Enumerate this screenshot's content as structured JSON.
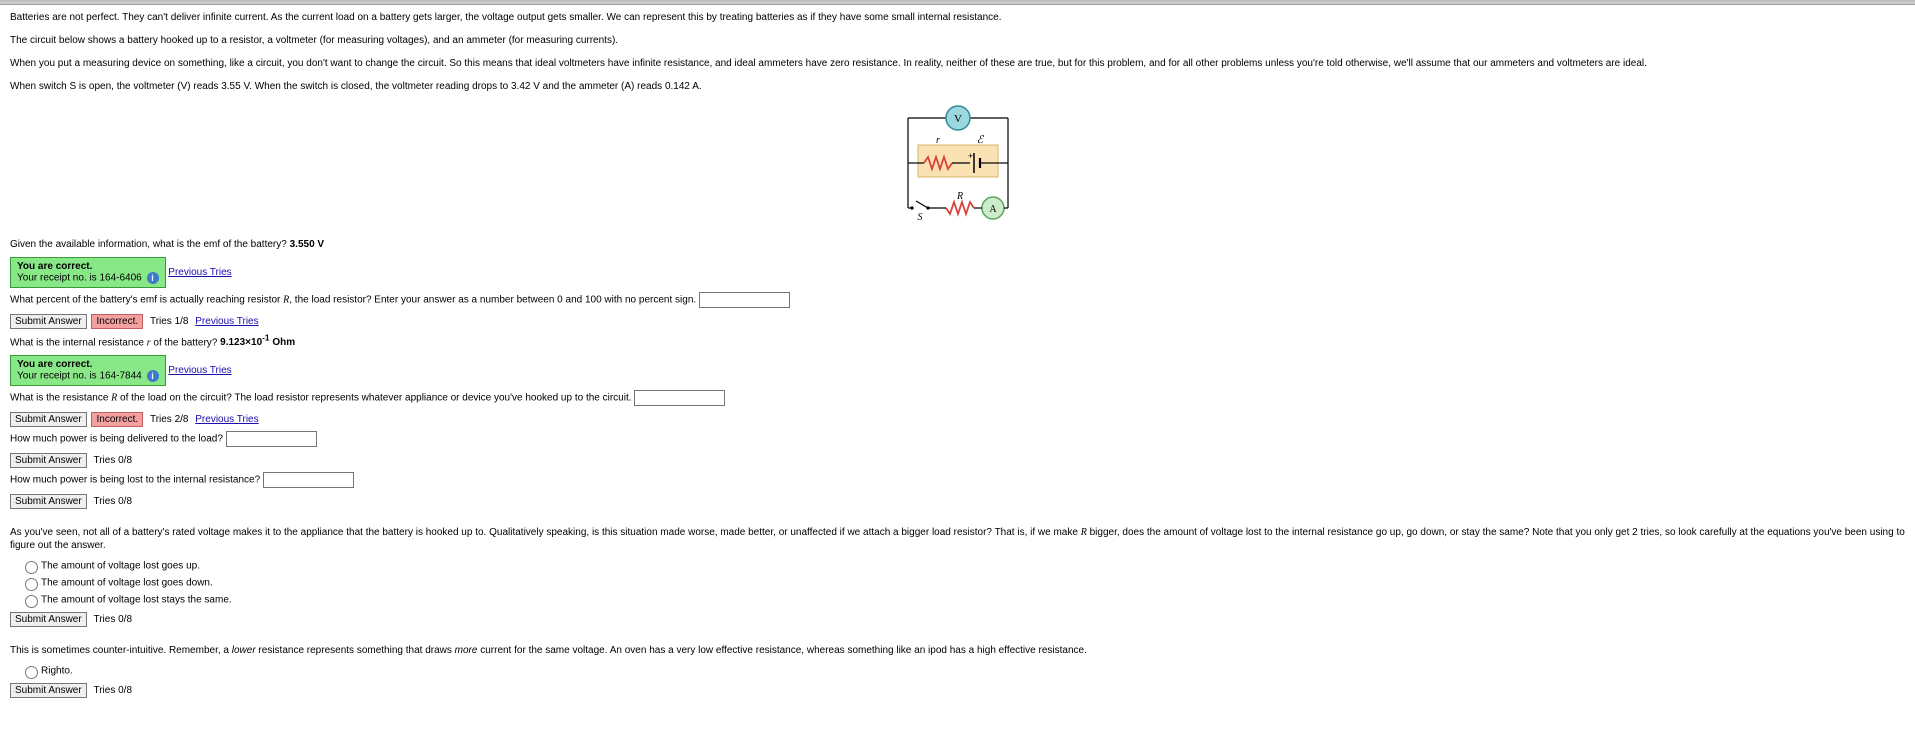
{
  "intro": {
    "p1": "Batteries are not perfect. They can't deliver infinite current. As the current load on a battery gets larger, the voltage output gets smaller. We can represent this by treating batteries as if they have some small internal resistance.",
    "p2": "The circuit below shows a battery hooked up to a resistor, a voltmeter (for measuring voltages), and an ammeter (for measuring currents).",
    "p3": "When you put a measuring device on something, like a circuit, you don't want to change the circuit. So this means that ideal voltmeters have infinite resistance, and ideal ammeters have zero resistance. In reality, neither of these are true, but for this problem, and for all other problems unless you're told otherwise, we'll assume that our ammeters and voltmeters are ideal.",
    "p4": "When switch S is open, the voltmeter (V) reads 3.55 V. When the switch is closed, the voltmeter reading drops to 3.42 V and the ammeter (A) reads 0.142 A."
  },
  "q1": {
    "prompt": "Given the available information, what is the emf of the battery? ",
    "answer": "3.550 V",
    "correct_line1": "You are correct.",
    "correct_line2": "Your receipt no. is 164-6406",
    "prev_tries": "Previous Tries"
  },
  "q2": {
    "prompt_a": "What percent of the battery's emf is actually reaching resistor ",
    "prompt_b": ", the load resistor? Enter your answer as a number between 0 and 100 with no percent sign.",
    "submit": "Submit Answer",
    "incorrect": "Incorrect.",
    "tries": "Tries 1/8",
    "prev_tries": "Previous Tries"
  },
  "q3": {
    "prompt_a": "What is the internal resistance ",
    "prompt_b": " of the battery? ",
    "answer_a": "9.123×10",
    "answer_exp": "-1",
    "answer_b": " Ohm",
    "correct_line1": "You are correct.",
    "correct_line2": "Your receipt no. is 164-7844",
    "prev_tries": "Previous Tries"
  },
  "q4": {
    "prompt_a": "What is the resistance ",
    "prompt_b": " of the load on the circuit? The load resistor represents whatever appliance or device you've hooked up to the circuit.",
    "submit": "Submit Answer",
    "incorrect": "Incorrect.",
    "tries": "Tries 2/8",
    "prev_tries": "Previous Tries"
  },
  "q5": {
    "prompt": "How much power is being delivered to the load?",
    "submit": "Submit Answer",
    "tries": "Tries 0/8"
  },
  "q6": {
    "prompt": "How much power is being lost to the internal resistance?",
    "submit": "Submit Answer",
    "tries": "Tries 0/8"
  },
  "q7": {
    "prompt_a": "As you've seen, not all of a battery's rated voltage makes it to the appliance that the battery is hooked up to. Qualitatively speaking, is this situation made worse, made better, or unaffected if we attach a bigger load resistor? That is, if we make ",
    "prompt_b": " bigger, does the amount of voltage lost to the internal resistance go up, go down, or stay the same? Note that you only get 2 tries, so look carefully at the equations you've been using to figure out the answer.",
    "opt1": "The amount of voltage lost goes up.",
    "opt2": "The amount of voltage lost goes down.",
    "opt3": "The amount of voltage lost stays the same.",
    "submit": "Submit Answer",
    "tries": "Tries 0/8"
  },
  "q8": {
    "prompt_a": "This is sometimes counter-intuitive. Remember, a ",
    "prompt_it1": "lower",
    "prompt_b": " resistance represents something that draws ",
    "prompt_it2": "more",
    "prompt_c": " current for the same voltage. An oven has a very low effective resistance, whereas something like an ipod has a high effective resistance.",
    "opt1": "Righto.",
    "submit": "Submit Answer",
    "tries": "Tries 0/8"
  },
  "diagram": {
    "V": "V",
    "A": "A",
    "r": "r",
    "E": "ℰ",
    "R": "R",
    "S": "S"
  }
}
